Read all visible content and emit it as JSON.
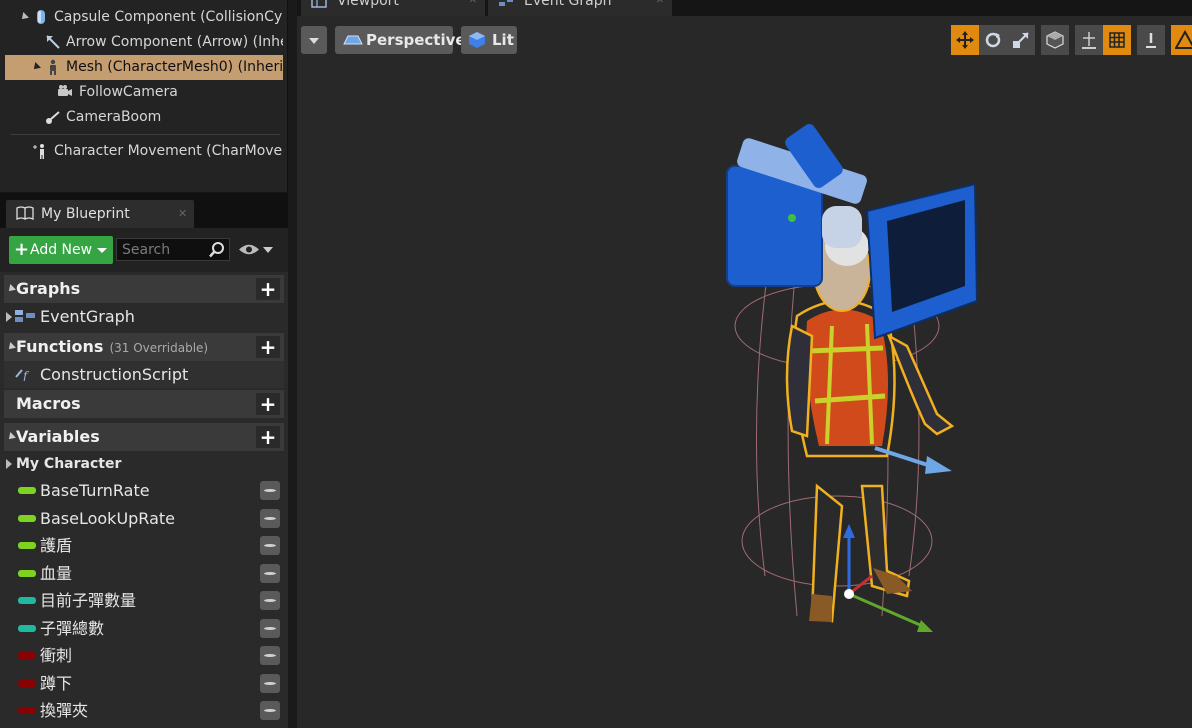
{
  "components": {
    "items": [
      {
        "label": "Capsule Component (CollisionCy",
        "icon": "capsule-icon"
      },
      {
        "label": "Arrow Component (Arrow) (Inhe",
        "icon": "arrow-icon"
      },
      {
        "label": "Mesh (CharacterMesh0) (Inherit",
        "icon": "skeletal-mesh-icon",
        "selected": true
      },
      {
        "label": "FollowCamera",
        "icon": "camera-icon"
      },
      {
        "label": "CameraBoom",
        "icon": "spring-arm-icon"
      },
      {
        "label": "Character Movement (CharMoveC",
        "icon": "movement-icon"
      }
    ]
  },
  "my_blueprint": {
    "tab_label": "My Blueprint",
    "add_new_label": "Add New",
    "search_placeholder": "Search",
    "sections": {
      "graphs": {
        "label": "Graphs",
        "items": [
          "EventGraph"
        ]
      },
      "functions": {
        "label": "Functions",
        "overridable": "(31 Overridable)",
        "items": [
          "ConstructionScript"
        ]
      },
      "macros": {
        "label": "Macros"
      },
      "variables": {
        "label": "Variables",
        "category": "My Character"
      }
    },
    "variables": [
      {
        "name": "BaseTurnRate",
        "type_color": "#7ed321"
      },
      {
        "name": "BaseLookUpRate",
        "type_color": "#7ed321"
      },
      {
        "name": "護盾",
        "type_color": "#7ed321"
      },
      {
        "name": "血量",
        "type_color": "#7ed321"
      },
      {
        "name": "目前子彈數量",
        "type_color": "#1fb8a0"
      },
      {
        "name": "子彈總數",
        "type_color": "#1fb8a0"
      },
      {
        "name": "衝刺",
        "type_color": "#8b0000"
      },
      {
        "name": "蹲下",
        "type_color": "#8b0000"
      },
      {
        "name": "換彈夾",
        "type_color": "#8b0000"
      }
    ]
  },
  "viewport": {
    "tabs": [
      {
        "label": "Viewport",
        "active": true
      },
      {
        "label": "Event Graph",
        "active": false
      }
    ],
    "perspective_label": "Perspective",
    "lit_label": "Lit",
    "accent_color": "#e08a10"
  }
}
